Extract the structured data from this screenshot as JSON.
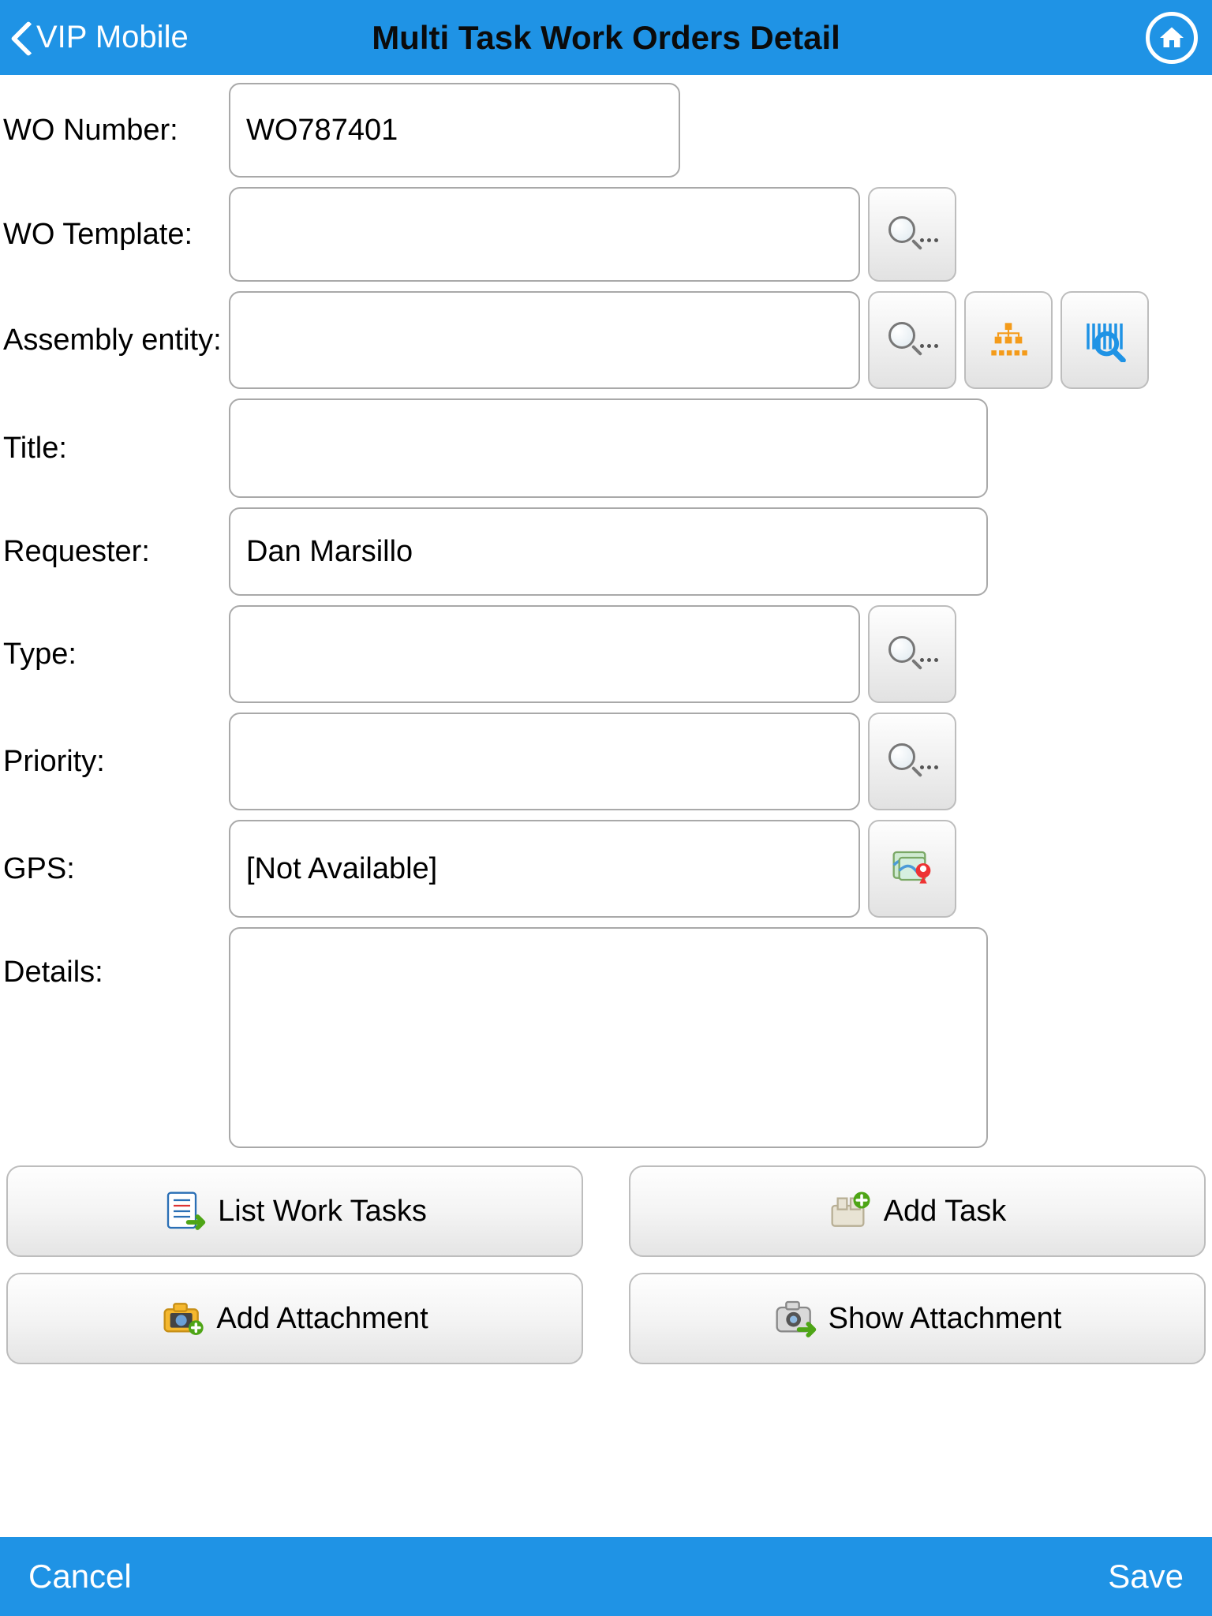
{
  "header": {
    "back_label": "VIP Mobile",
    "title": "Multi Task Work Orders Detail"
  },
  "form": {
    "wo_number": {
      "label": "WO Number:",
      "value": "WO787401"
    },
    "wo_template": {
      "label": "WO Template:",
      "value": ""
    },
    "assembly_entity": {
      "label": "Assembly entity:",
      "value": ""
    },
    "title": {
      "label": "Title:",
      "value": ""
    },
    "requester": {
      "label": "Requester:",
      "value": "Dan Marsillo"
    },
    "type": {
      "label": "Type:",
      "value": ""
    },
    "priority": {
      "label": "Priority:",
      "value": ""
    },
    "gps": {
      "label": "GPS:",
      "value": "[Not Available]"
    },
    "details": {
      "label": "Details:",
      "value": ""
    }
  },
  "actions": {
    "list_work_tasks": "List Work Tasks",
    "add_task": "Add Task",
    "add_attachment": "Add Attachment",
    "show_attachment": "Show Attachment"
  },
  "footer": {
    "cancel": "Cancel",
    "save": "Save"
  }
}
